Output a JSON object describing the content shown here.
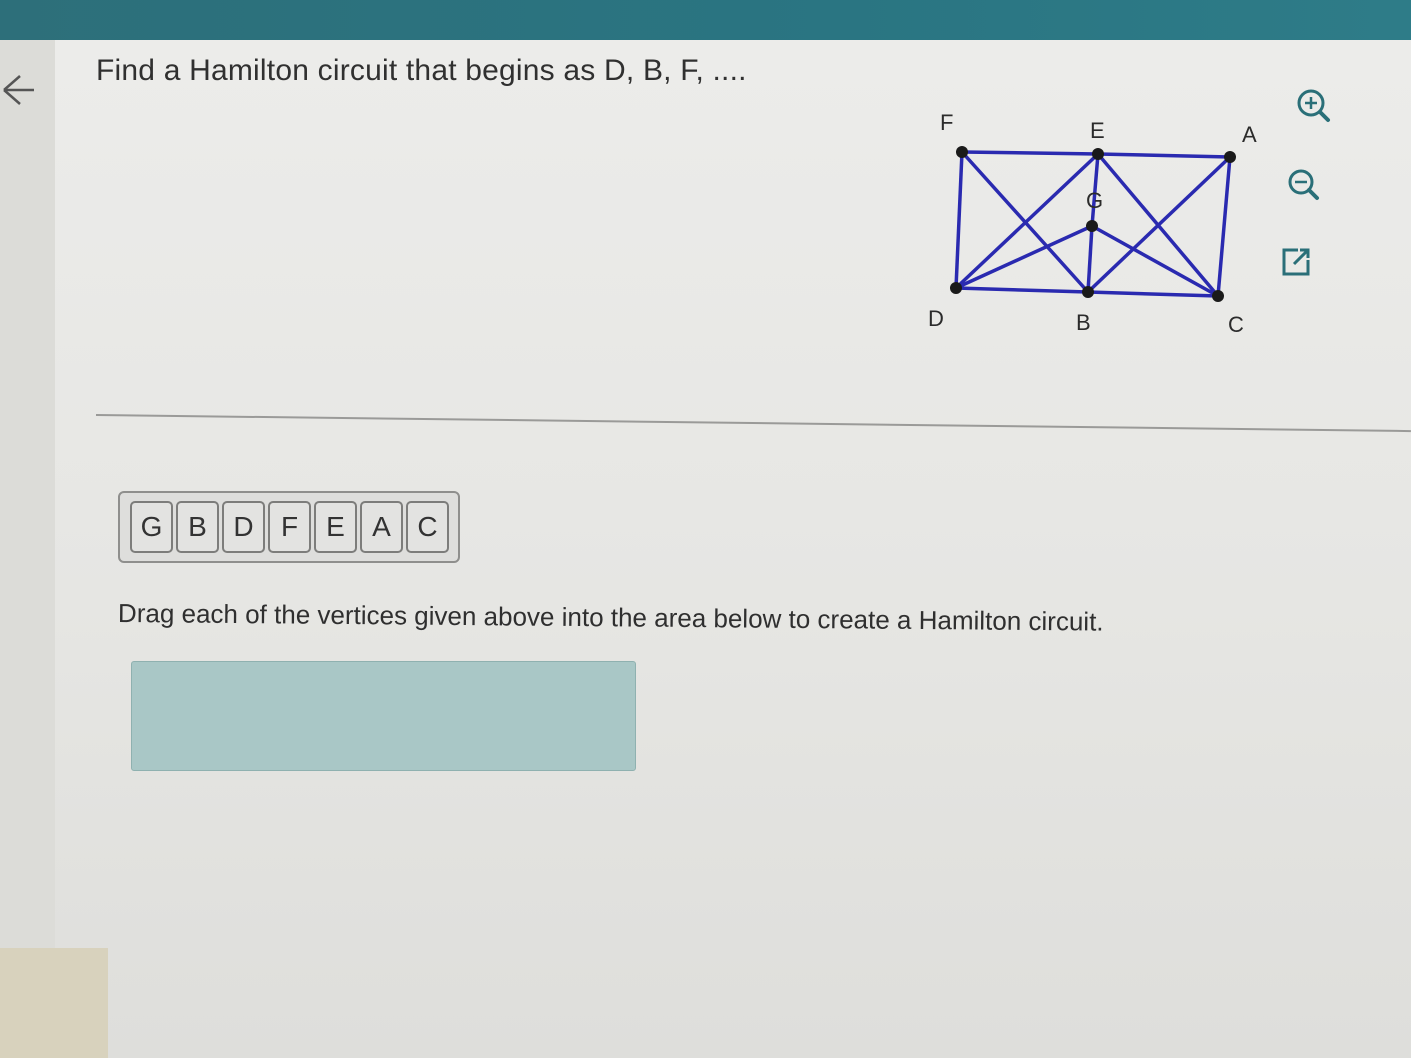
{
  "question": {
    "text": "Find a Hamilton circuit that begins as D, B, F, ...."
  },
  "graph": {
    "vertices": [
      {
        "id": "F",
        "label": "F"
      },
      {
        "id": "E",
        "label": "E"
      },
      {
        "id": "A",
        "label": "A"
      },
      {
        "id": "G",
        "label": "G"
      },
      {
        "id": "D",
        "label": "D"
      },
      {
        "id": "B",
        "label": "B"
      },
      {
        "id": "C",
        "label": "C"
      }
    ],
    "edges": [
      [
        "F",
        "E"
      ],
      [
        "E",
        "A"
      ],
      [
        "F",
        "D"
      ],
      [
        "D",
        "B"
      ],
      [
        "B",
        "C"
      ],
      [
        "A",
        "C"
      ],
      [
        "F",
        "B"
      ],
      [
        "D",
        "E"
      ],
      [
        "E",
        "G"
      ],
      [
        "G",
        "B"
      ],
      [
        "G",
        "D"
      ],
      [
        "G",
        "C"
      ],
      [
        "E",
        "C"
      ],
      [
        "A",
        "B"
      ]
    ],
    "edge_color": "#2a2ab0"
  },
  "tools": {
    "zoom_in": "zoom-in-icon",
    "zoom_out": "zoom-out-icon",
    "popout": "external-link-icon"
  },
  "tiles": [
    "G",
    "B",
    "D",
    "F",
    "E",
    "A",
    "C"
  ],
  "instruction": {
    "text": "Drag each of the vertices given above into the area below to create a Hamilton circuit."
  },
  "colors": {
    "top_bar": "#2a7582",
    "drop_area": "#a9c7c6"
  }
}
